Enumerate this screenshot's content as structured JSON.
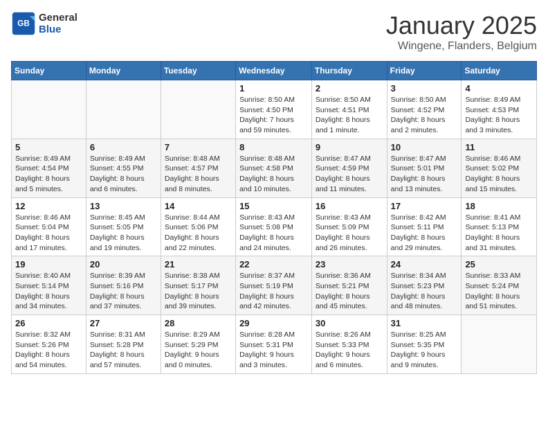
{
  "header": {
    "logo_line1": "General",
    "logo_line2": "Blue",
    "month": "January 2025",
    "location": "Wingene, Flanders, Belgium"
  },
  "weekdays": [
    "Sunday",
    "Monday",
    "Tuesday",
    "Wednesday",
    "Thursday",
    "Friday",
    "Saturday"
  ],
  "weeks": [
    [
      {
        "day": "",
        "info": ""
      },
      {
        "day": "",
        "info": ""
      },
      {
        "day": "",
        "info": ""
      },
      {
        "day": "1",
        "info": "Sunrise: 8:50 AM\nSunset: 4:50 PM\nDaylight: 7 hours\nand 59 minutes."
      },
      {
        "day": "2",
        "info": "Sunrise: 8:50 AM\nSunset: 4:51 PM\nDaylight: 8 hours\nand 1 minute."
      },
      {
        "day": "3",
        "info": "Sunrise: 8:50 AM\nSunset: 4:52 PM\nDaylight: 8 hours\nand 2 minutes."
      },
      {
        "day": "4",
        "info": "Sunrise: 8:49 AM\nSunset: 4:53 PM\nDaylight: 8 hours\nand 3 minutes."
      }
    ],
    [
      {
        "day": "5",
        "info": "Sunrise: 8:49 AM\nSunset: 4:54 PM\nDaylight: 8 hours\nand 5 minutes."
      },
      {
        "day": "6",
        "info": "Sunrise: 8:49 AM\nSunset: 4:55 PM\nDaylight: 8 hours\nand 6 minutes."
      },
      {
        "day": "7",
        "info": "Sunrise: 8:48 AM\nSunset: 4:57 PM\nDaylight: 8 hours\nand 8 minutes."
      },
      {
        "day": "8",
        "info": "Sunrise: 8:48 AM\nSunset: 4:58 PM\nDaylight: 8 hours\nand 10 minutes."
      },
      {
        "day": "9",
        "info": "Sunrise: 8:47 AM\nSunset: 4:59 PM\nDaylight: 8 hours\nand 11 minutes."
      },
      {
        "day": "10",
        "info": "Sunrise: 8:47 AM\nSunset: 5:01 PM\nDaylight: 8 hours\nand 13 minutes."
      },
      {
        "day": "11",
        "info": "Sunrise: 8:46 AM\nSunset: 5:02 PM\nDaylight: 8 hours\nand 15 minutes."
      }
    ],
    [
      {
        "day": "12",
        "info": "Sunrise: 8:46 AM\nSunset: 5:04 PM\nDaylight: 8 hours\nand 17 minutes."
      },
      {
        "day": "13",
        "info": "Sunrise: 8:45 AM\nSunset: 5:05 PM\nDaylight: 8 hours\nand 19 minutes."
      },
      {
        "day": "14",
        "info": "Sunrise: 8:44 AM\nSunset: 5:06 PM\nDaylight: 8 hours\nand 22 minutes."
      },
      {
        "day": "15",
        "info": "Sunrise: 8:43 AM\nSunset: 5:08 PM\nDaylight: 8 hours\nand 24 minutes."
      },
      {
        "day": "16",
        "info": "Sunrise: 8:43 AM\nSunset: 5:09 PM\nDaylight: 8 hours\nand 26 minutes."
      },
      {
        "day": "17",
        "info": "Sunrise: 8:42 AM\nSunset: 5:11 PM\nDaylight: 8 hours\nand 29 minutes."
      },
      {
        "day": "18",
        "info": "Sunrise: 8:41 AM\nSunset: 5:13 PM\nDaylight: 8 hours\nand 31 minutes."
      }
    ],
    [
      {
        "day": "19",
        "info": "Sunrise: 8:40 AM\nSunset: 5:14 PM\nDaylight: 8 hours\nand 34 minutes."
      },
      {
        "day": "20",
        "info": "Sunrise: 8:39 AM\nSunset: 5:16 PM\nDaylight: 8 hours\nand 37 minutes."
      },
      {
        "day": "21",
        "info": "Sunrise: 8:38 AM\nSunset: 5:17 PM\nDaylight: 8 hours\nand 39 minutes."
      },
      {
        "day": "22",
        "info": "Sunrise: 8:37 AM\nSunset: 5:19 PM\nDaylight: 8 hours\nand 42 minutes."
      },
      {
        "day": "23",
        "info": "Sunrise: 8:36 AM\nSunset: 5:21 PM\nDaylight: 8 hours\nand 45 minutes."
      },
      {
        "day": "24",
        "info": "Sunrise: 8:34 AM\nSunset: 5:23 PM\nDaylight: 8 hours\nand 48 minutes."
      },
      {
        "day": "25",
        "info": "Sunrise: 8:33 AM\nSunset: 5:24 PM\nDaylight: 8 hours\nand 51 minutes."
      }
    ],
    [
      {
        "day": "26",
        "info": "Sunrise: 8:32 AM\nSunset: 5:26 PM\nDaylight: 8 hours\nand 54 minutes."
      },
      {
        "day": "27",
        "info": "Sunrise: 8:31 AM\nSunset: 5:28 PM\nDaylight: 8 hours\nand 57 minutes."
      },
      {
        "day": "28",
        "info": "Sunrise: 8:29 AM\nSunset: 5:29 PM\nDaylight: 9 hours\nand 0 minutes."
      },
      {
        "day": "29",
        "info": "Sunrise: 8:28 AM\nSunset: 5:31 PM\nDaylight: 9 hours\nand 3 minutes."
      },
      {
        "day": "30",
        "info": "Sunrise: 8:26 AM\nSunset: 5:33 PM\nDaylight: 9 hours\nand 6 minutes."
      },
      {
        "day": "31",
        "info": "Sunrise: 8:25 AM\nSunset: 5:35 PM\nDaylight: 9 hours\nand 9 minutes."
      },
      {
        "day": "",
        "info": ""
      }
    ]
  ]
}
